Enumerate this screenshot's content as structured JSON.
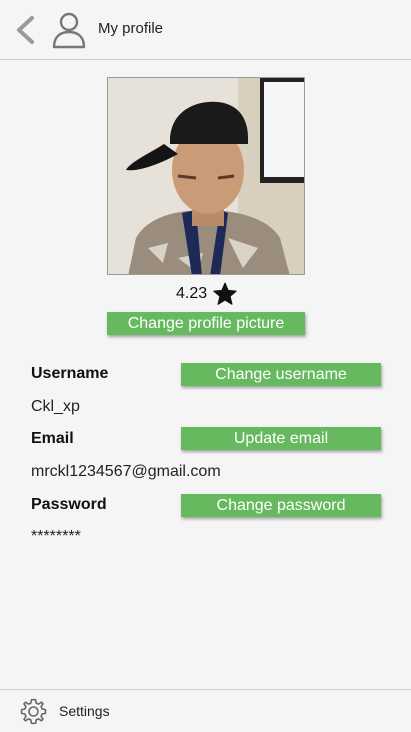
{
  "header": {
    "title": "My profile",
    "back_icon": "chevron-left-icon",
    "profile_icon": "user-outline-icon"
  },
  "profile": {
    "rating": "4.23",
    "rating_icon": "star-icon",
    "change_picture_label": "Change profile picture"
  },
  "fields": {
    "username": {
      "label": "Username",
      "value": "Ckl_xp",
      "button": "Change username"
    },
    "email": {
      "label": "Email",
      "value": "mrckl1234567@gmail.com",
      "button": "Update email"
    },
    "password": {
      "label": "Password",
      "value": "********",
      "button": "Change password"
    }
  },
  "footer": {
    "settings_label": "Settings",
    "settings_icon": "gear-icon"
  },
  "colors": {
    "accent_green": "#67b960",
    "background": "#f5f5f5"
  }
}
